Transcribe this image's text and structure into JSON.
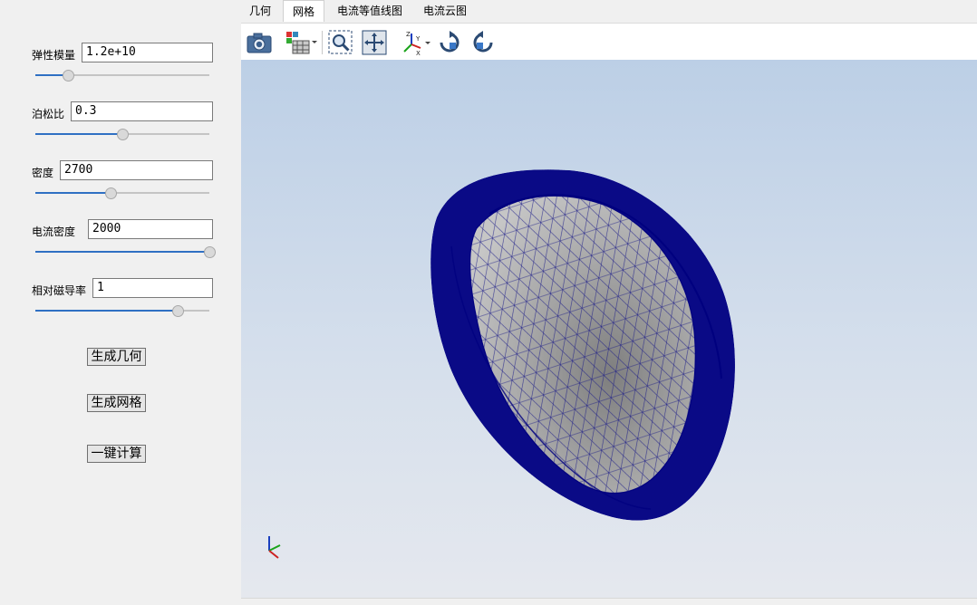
{
  "params": [
    {
      "label": "弹性模量",
      "value": "1.2e+10",
      "slider_fraction": 0.19
    },
    {
      "label": "泊松比",
      "value": "0.3",
      "slider_fraction": 0.5
    },
    {
      "label": "密度",
      "value": "2700",
      "slider_fraction": 0.43
    },
    {
      "label": "电流密度",
      "value": "2000",
      "slider_fraction": 1.0
    },
    {
      "label": "相对磁导率",
      "value": "1",
      "slider_fraction": 0.82
    }
  ],
  "buttons": {
    "generate_geometry": "生成几何",
    "generate_mesh": "生成网格",
    "one_click_compute": "一键计算"
  },
  "tabs": [
    {
      "label": "几何",
      "active": false
    },
    {
      "label": "网格",
      "active": true
    },
    {
      "label": "电流等值线图",
      "active": false
    },
    {
      "label": "电流云图",
      "active": false
    }
  ],
  "toolbar": {
    "icons": [
      "camera-icon",
      "display-mode-icon",
      "zoom-box-icon",
      "fit-view-icon",
      "axes-view-icon",
      "rotate-cw-icon",
      "rotate-ccw-icon"
    ]
  },
  "viewport": {
    "mesh_color": "#00007f",
    "surface_color": "#a9a9a9",
    "background_top": "#bccfe6",
    "background_bottom": "#e5e8ee"
  }
}
